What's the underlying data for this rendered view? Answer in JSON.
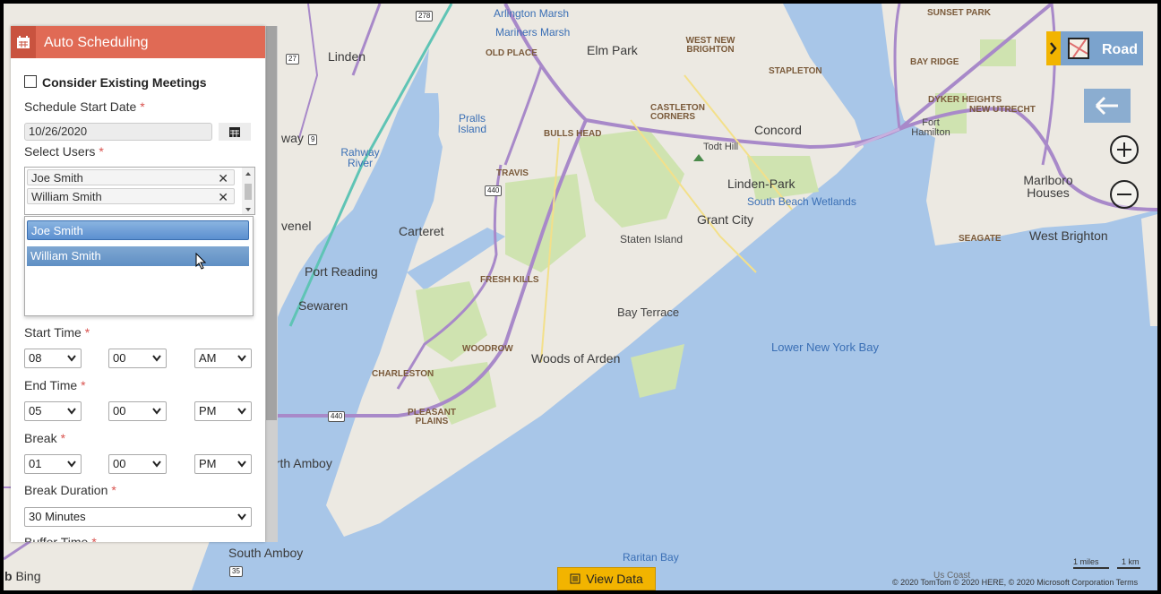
{
  "panel": {
    "title": "Auto Scheduling",
    "consider_existing": "Consider Existing Meetings",
    "schedule_start_label": "Schedule Start Date",
    "schedule_start_value": "10/26/2020",
    "select_users_label": "Select Users",
    "selected_users": [
      "Joe Smith",
      "William Smith"
    ],
    "dropdown_options": [
      "Joe Smith",
      "William Smith"
    ],
    "start_time_label": "Start Time",
    "start_time": {
      "hour": "08",
      "minute": "00",
      "ampm": "AM"
    },
    "end_time_label": "End Time",
    "end_time": {
      "hour": "05",
      "minute": "00",
      "ampm": "PM"
    },
    "break_label": "Break",
    "break_time": {
      "hour": "01",
      "minute": "00",
      "ampm": "PM"
    },
    "break_duration_label": "Break Duration",
    "break_duration_value": "30 Minutes",
    "buffer_time_label": "Buffer Time",
    "required_mark": "*",
    "remove_mark": "✕"
  },
  "map": {
    "labels": {
      "arlington_marsh": "Arlington Marsh",
      "mariners_marsh": "Mariners Marsh",
      "old_place": "OLD PLACE",
      "elm_park": "Elm Park",
      "west_new_brighton": "WEST NEW BRIGHTON",
      "stapleton": "STAPLETON",
      "sunset_park": "SUNSET PARK",
      "bay_ridge": "BAY RIDGE",
      "dyker_heights": "DYKER HEIGHTS",
      "new_utrecht": "NEW UTRECHT",
      "fort_hamilton": "Fort Hamilton",
      "linden": "Linden",
      "marlboro_houses": "Marlboro Houses",
      "prall_island": "Pralls Island",
      "castleton_corners": "CASTLETON CORNERS",
      "concord": "Concord",
      "bulls_head": "BULLS HEAD",
      "todt_hill": "Todt Hill",
      "rahway_river": "Rahway River",
      "travis": "TRAVIS",
      "linden_park": "Linden-Park",
      "south_beach_wetlands": "South Beach Wetlands",
      "seagate": "SEAGATE",
      "west_brighton": "West Brighton",
      "carteret": "Carteret",
      "grant_city": "Grant City",
      "staten_island": "Staten Island",
      "avenel": "venel",
      "port_reading": "Port Reading",
      "sewaren": "Sewaren",
      "fresh_kills": "FRESH KILLS",
      "bay_terrace": "Bay Terrace",
      "woodrow": "WOODROW",
      "lower_ny_bay": "Lower New York Bay",
      "charleston": "CHARLESTON",
      "woods_of_arden": "Woods of Arden",
      "pleasant_plains": "PLEASANT PLAINS",
      "perth_amboy": "erth Amboy",
      "south_amboy": "South Amboy",
      "raritan_bay": "Raritan Bay",
      "way": "way",
      "us_coast": "Us Coast"
    },
    "shields": [
      "278",
      "27",
      "9",
      "440",
      "440",
      "35"
    ]
  },
  "controls": {
    "map_style": "Road",
    "view_data": "View Data",
    "bing": "Bing",
    "scale_miles": "1 miles",
    "scale_km": "1 km",
    "attribution": "© 2020 TomTom © 2020 HERE, © 2020 Microsoft Corporation  Terms"
  },
  "colors": {
    "header": "#e06a55",
    "header_icon_bg": "#c9533f",
    "water": "#a8c6e8",
    "land": "#ece9e2",
    "park": "#cfe3b0",
    "highway": "#a889c9",
    "view_data": "#f2b400",
    "road_button": "#7ba3cd"
  }
}
